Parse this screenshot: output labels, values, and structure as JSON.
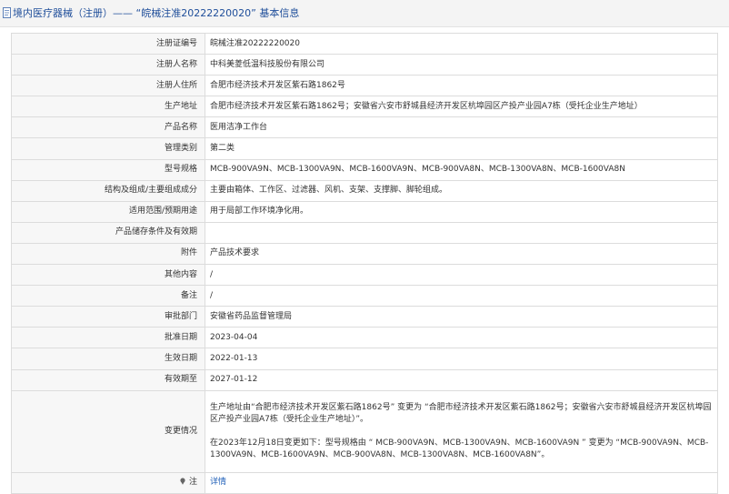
{
  "header": {
    "title": "境内医疗器械（注册）—— “皖械注准20222220020” 基本信息"
  },
  "rows": [
    {
      "label": "注册证编号",
      "value": "皖械注准20222220020"
    },
    {
      "label": "注册人名称",
      "value": "中科美菱低温科技股份有限公司"
    },
    {
      "label": "注册人住所",
      "value": "合肥市经济技术开发区紫石路1862号"
    },
    {
      "label": "生产地址",
      "value": "合肥市经济技术开发区紫石路1862号；安徽省六安市舒城县经济开发区杭埠园区产投产业园A7栋（受托企业生产地址）"
    },
    {
      "label": "产品名称",
      "value": "医用洁净工作台"
    },
    {
      "label": "管理类别",
      "value": "第二类"
    },
    {
      "label": "型号规格",
      "value": "MCB-900VA9N、MCB-1300VA9N、MCB-1600VA9N、MCB-900VA8N、MCB-1300VA8N、MCB-1600VA8N"
    },
    {
      "label": "结构及组成/主要组成成分",
      "value": "主要由箱体、工作区、过滤器、风机、支架、支撑脚、脚轮组成。"
    },
    {
      "label": "适用范围/预期用途",
      "value": "用于局部工作环境净化用。"
    },
    {
      "label": "产品储存条件及有效期",
      "value": ""
    },
    {
      "label": "附件",
      "value": "产品技术要求"
    },
    {
      "label": "其他内容",
      "value": "/"
    },
    {
      "label": "备注",
      "value": "/"
    },
    {
      "label": "审批部门",
      "value": "安徽省药品监督管理局"
    },
    {
      "label": "批准日期",
      "value": "2023-04-04"
    },
    {
      "label": "生效日期",
      "value": "2022-01-13"
    },
    {
      "label": "有效期至",
      "value": "2027-01-12"
    }
  ],
  "changes": {
    "label": "变更情况",
    "p1": "生产地址由“合肥市经济技术开发区紫石路1862号” 变更为 “合肥市经济技术开发区紫石路1862号；安徽省六安市舒城县经济开发区杭埠园区产投产业园A7栋（受托企业生产地址）”。",
    "p2": "在2023年12月18日变更如下：型号规格由 “ MCB-900VA9N、MCB-1300VA9N、MCB-1600VA9N ” 变更为 “MCB-900VA9N、MCB-1300VA9N、MCB-1600VA9N、MCB-900VA8N、MCB-1300VA8N、MCB-1600VA8N”。"
  },
  "detail": {
    "label": "注",
    "link": "详情"
  },
  "colors": {
    "title": "#1f4e9a",
    "link": "#1f5fb8",
    "label_bg": "#f7f7f7",
    "border": "#dcdcdc"
  }
}
